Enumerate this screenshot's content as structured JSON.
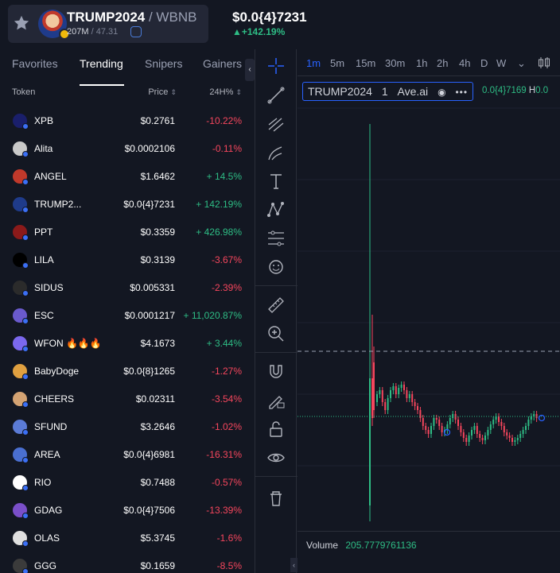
{
  "header": {
    "pair_name": "TRUMP2024",
    "quote_sep": " / WBNB",
    "market_cap": "207M",
    "liquidity": " / 47.31",
    "price": "$0.0{4}7231",
    "change": "▲+142.19%"
  },
  "tabs": [
    "Favorites",
    "Trending",
    "Snipers",
    "Gainers"
  ],
  "table": {
    "col_token": "Token",
    "col_price": "Price",
    "col_change": "24H%",
    "rows": [
      {
        "name": "XPB",
        "price": "$0.2761",
        "change": "-10.22%",
        "dir": "down",
        "color": "#1a1f6b"
      },
      {
        "name": "Alita",
        "price": "$0.0002106",
        "change": "-0.11%",
        "dir": "down",
        "color": "#c9c9c9"
      },
      {
        "name": "ANGEL",
        "price": "$1.6462",
        "change": "+ 14.5%",
        "dir": "up",
        "color": "#c0392b"
      },
      {
        "name": "TRUMP2...",
        "price": "$0.0{4}7231",
        "change": "+ 142.19%",
        "dir": "up",
        "color": "#1f3b8a"
      },
      {
        "name": "PPT",
        "price": "$0.3359",
        "change": "+ 426.98%",
        "dir": "up",
        "color": "#8b1a1a"
      },
      {
        "name": "LILA",
        "price": "$0.3139",
        "change": "-3.67%",
        "dir": "down",
        "color": "#000000"
      },
      {
        "name": "SIDUS",
        "price": "$0.005331",
        "change": "-2.39%",
        "dir": "down",
        "color": "#2b2b2b"
      },
      {
        "name": "ESC",
        "price": "$0.0001217",
        "change": "+ 11,020.87%",
        "dir": "up",
        "color": "#6a5acd"
      },
      {
        "name": "WFON 🔥🔥🔥",
        "price": "$4.1673",
        "change": "+ 3.44%",
        "dir": "up",
        "color": "#7b68ee"
      },
      {
        "name": "BabyDoge",
        "price": "$0.0{8}1265",
        "change": "-1.27%",
        "dir": "down",
        "color": "#e0a040"
      },
      {
        "name": "CHEERS",
        "price": "$0.02311",
        "change": "-3.54%",
        "dir": "down",
        "color": "#d4a373"
      },
      {
        "name": "SFUND",
        "price": "$3.2646",
        "change": "-1.02%",
        "dir": "down",
        "color": "#5b7bd6"
      },
      {
        "name": "AREA",
        "price": "$0.0{4}6981",
        "change": "-16.31%",
        "dir": "down",
        "color": "#4a6fd0"
      },
      {
        "name": "RIO",
        "price": "$0.7488",
        "change": "-0.57%",
        "dir": "down",
        "color": "#ffffff"
      },
      {
        "name": "GDAG",
        "price": "$0.0{4}7506",
        "change": "-13.39%",
        "dir": "down",
        "color": "#7a4fc9"
      },
      {
        "name": "OLAS",
        "price": "$5.3745",
        "change": "-1.6%",
        "dir": "down",
        "color": "#e0e0e0"
      },
      {
        "name": "GGG",
        "price": "$0.1659",
        "change": "-8.5%",
        "dir": "down",
        "color": "#3b3b3b"
      }
    ]
  },
  "chart": {
    "intervals": [
      "1m",
      "5m",
      "15m",
      "30m",
      "1h",
      "2h",
      "4h",
      "D",
      "W"
    ],
    "active_interval": "1m",
    "legend_symbol": "TRUMP2024",
    "legend_interval": "1",
    "legend_source": "Ave.ai",
    "legend_open": "0.0{4}7169",
    "legend_high_label": "H",
    "legend_high": "0.0",
    "volume_label": "Volume",
    "volume_value": "205.7779761136",
    "up_color": "#2ebd85",
    "down_color": "#f6465d"
  }
}
